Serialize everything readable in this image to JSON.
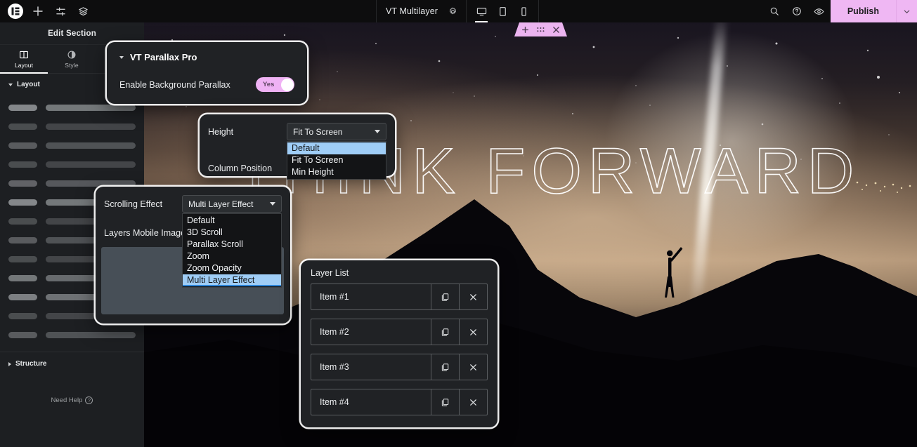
{
  "topbar": {
    "logo_icon": "elementor-logo-icon",
    "add_icon": "plus-icon",
    "settings_icon": "sliders-icon",
    "layers_icon": "layers-icon",
    "document_title": "VT Multilayer",
    "gear_icon": "gear-icon",
    "devices": [
      {
        "name": "desktop",
        "icon": "desktop-icon",
        "active": true
      },
      {
        "name": "tablet",
        "icon": "tablet-icon",
        "active": false
      },
      {
        "name": "mobile",
        "icon": "mobile-icon",
        "active": false
      }
    ],
    "search_icon": "search-icon",
    "help_icon": "help-circle-icon",
    "preview_icon": "eye-icon",
    "publish_label": "Publish",
    "publish_caret_icon": "chevron-down-icon",
    "publish_color": "#efb7f3"
  },
  "sidebar": {
    "header": "Edit Section",
    "tabs": [
      {
        "label": "Layout",
        "icon": "layout-columns-icon",
        "active": true
      },
      {
        "label": "Style",
        "icon": "contrast-circle-icon",
        "active": false
      }
    ],
    "layout_section_title": "Layout",
    "structure_section_title": "Structure",
    "need_help_label": "Need Help",
    "need_help_icon": "question-circle-icon",
    "skeleton_rows": 13
  },
  "canvas": {
    "section_toolbar": {
      "add_icon": "plus-icon",
      "drag_icon": "drag-handle-icon",
      "close_icon": "close-icon",
      "color": "#ecb4f0"
    },
    "hero_text": "THINK FORWARD"
  },
  "panels": {
    "parallax": {
      "title": "VT Parallax Pro",
      "collapse_icon": "caret-down-icon",
      "enable_label": "Enable Background Parallax",
      "toggle_value": "Yes",
      "toggle_on": true
    },
    "height": {
      "height_label": "Height",
      "height_value": "Fit To Screen",
      "height_options": [
        "Default",
        "Fit To Screen",
        "Min Height"
      ],
      "height_highlighted": "Default",
      "column_position_label": "Column Position",
      "dropdown_icon": "caret-down-icon"
    },
    "scrolling": {
      "scrolling_label": "Scrolling Effect",
      "scrolling_value": "Multi Layer Effect",
      "scrolling_options": [
        "Default",
        "3D Scroll",
        "Parallax Scroll",
        "Zoom",
        "Zoom Opacity",
        "Multi Layer Effect"
      ],
      "scrolling_highlighted": "Multi Layer Effect",
      "layers_mobile_image_label": "Layers Mobile Image",
      "upload_icon": "plus-icon",
      "dropdown_icon": "caret-down-icon"
    },
    "layer_list": {
      "title": "Layer List",
      "duplicate_icon": "copy-icon",
      "remove_icon": "close-icon",
      "items": [
        {
          "label": "Item #1"
        },
        {
          "label": "Item #2"
        },
        {
          "label": "Item #3"
        },
        {
          "label": "Item #4"
        }
      ]
    }
  }
}
